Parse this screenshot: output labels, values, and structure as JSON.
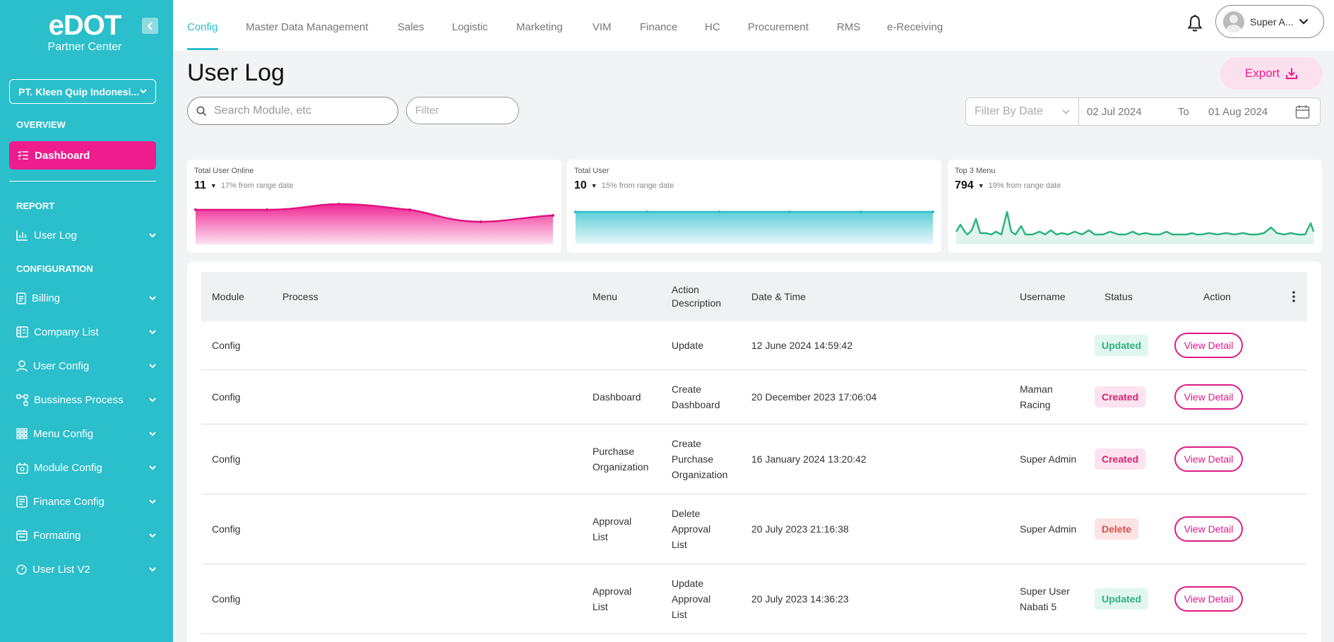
{
  "sidebar": {
    "logo_brand": "eDOT",
    "logo_sub": "Partner Center",
    "company": "PT. Kleen Quip Indonesi...",
    "overview_title": "OVERVIEW",
    "dashboard_label": "Dashboard",
    "report_title": "REPORT",
    "configuration_title": "CONFIGURATION",
    "items": [
      {
        "label": "User Log",
        "icon": "bar-chart-icon"
      },
      {
        "label": "Billing",
        "icon": "document-icon"
      },
      {
        "label": "Company List",
        "icon": "building-icon"
      },
      {
        "label": "User Config",
        "icon": "user-icon"
      },
      {
        "label": "Bussiness Process",
        "icon": "flow-icon"
      },
      {
        "label": "Menu Config",
        "icon": "grid-icon"
      },
      {
        "label": "Module Config",
        "icon": "module-icon"
      },
      {
        "label": "Finance Config",
        "icon": "receipt-icon"
      },
      {
        "label": "Formating",
        "icon": "calendar-icon"
      },
      {
        "label": "User List V2",
        "icon": "dashboard-icon"
      }
    ]
  },
  "topbar": {
    "tabs": [
      "Config",
      "Master Data Management",
      "Sales",
      "Logistic",
      "Marketing",
      "VIM",
      "Finance",
      "HC",
      "Procurement",
      "RMS",
      "e-Receiving"
    ],
    "active_tab": "Config",
    "user_name": "Super A..."
  },
  "header": {
    "title": "User Log",
    "export_label": "Export",
    "search_placeholder": "Search Module, etc",
    "filter_placeholder": "Filter",
    "date_filter_label": "Filter By Date",
    "date_from": "02 Jul 2024",
    "date_to_label": "To",
    "date_to": "01 Aug 2024"
  },
  "cards": [
    {
      "title": "Total User Online",
      "value": "11",
      "delta": "17% from range date"
    },
    {
      "title": "Total User",
      "value": "10",
      "delta": "15% from range date"
    },
    {
      "title": "Top 3 Menu",
      "value": "794",
      "delta": "19% from range date"
    }
  ],
  "table": {
    "headers": {
      "module": "Module",
      "process": "Process",
      "menu": "Menu",
      "action_desc": "Action Description",
      "datetime": "Date & Time",
      "username": "Username",
      "status": "Status",
      "action": "Action"
    },
    "view_label": "View Detail",
    "rows": [
      {
        "module": "Config",
        "process": "",
        "menu": "",
        "action": "Update",
        "datetime": "12 June 2024 14:59:42",
        "username": "",
        "status": "Updated"
      },
      {
        "module": "Config",
        "process": "",
        "menu": "Dashboard",
        "action": "Create Dashboard",
        "datetime": "20 December 2023 17:06:04",
        "username": "Maman Racing",
        "status": "Created"
      },
      {
        "module": "Config",
        "process": "",
        "menu": "Purchase Organization",
        "action": "Create Purchase Organization",
        "datetime": "16 January 2024 13:20:42",
        "username": "Super Admin",
        "status": "Created"
      },
      {
        "module": "Config",
        "process": "",
        "menu": "Approval List",
        "action": "Delete Approval List",
        "datetime": "20 July 2023 21:16:38",
        "username": "Super Admin",
        "status": "Delete"
      },
      {
        "module": "Config",
        "process": "",
        "menu": "Approval List",
        "action": "Update Approval List",
        "datetime": "20 July 2023 14:36:23",
        "username": "Super User Nabati 5",
        "status": "Updated"
      }
    ]
  },
  "colors": {
    "sidebar": "#2bbecb",
    "accent_pink": "#ee1c8d",
    "updated": "#2db37e",
    "created": "#d4246f",
    "delete": "#e04c4c"
  }
}
